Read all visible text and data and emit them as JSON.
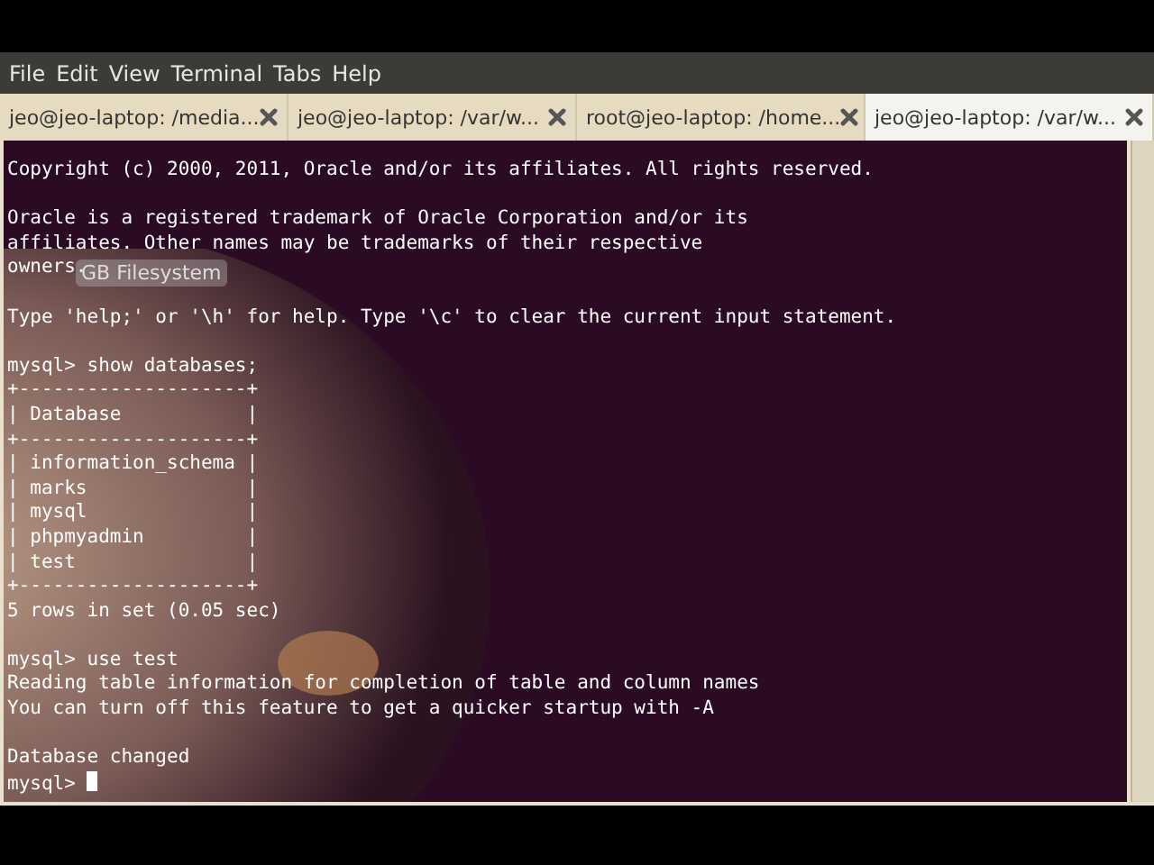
{
  "menu_bar": [
    "File",
    "Edit",
    "View",
    "Terminal",
    "Tabs",
    "Help"
  ],
  "tabs": [
    {
      "title": "jeo@jeo-laptop: /media...",
      "selected": false
    },
    {
      "title": "jeo@jeo-laptop: /var/w...",
      "selected": false
    },
    {
      "title": "root@jeo-laptop: /home...",
      "selected": false
    },
    {
      "title": "jeo@jeo-laptop: /var/w...",
      "selected": true
    }
  ],
  "terminal": {
    "blocks": [
      [
        "Copyright (c) 2000, 2011, Oracle and/or its affiliates. All rights reserved."
      ],
      [
        "Oracle is a registered trademark of Oracle Corporation and/or its",
        "affiliates. Other names may be trademarks of their respective",
        "owners."
      ],
      [
        "Type 'help;' or '\\h' for help. Type '\\c' to clear the current input statement."
      ],
      [
        "mysql> show databases;",
        "+--------------------+",
        "| Database           |",
        "+--------------------+",
        "| information_schema |",
        "| marks              |",
        "| mysql              |",
        "| phpmyadmin         |",
        "| test               |",
        "+--------------------+",
        "5 rows in set (0.05 sec)"
      ],
      [
        "mysql> use test",
        "Reading table information for completion of table and column names",
        "You can turn off this feature to get a quicker startup with -A"
      ],
      [
        "Database changed",
        "mysql> "
      ]
    ]
  },
  "overlay_label": "GB Filesystem"
}
